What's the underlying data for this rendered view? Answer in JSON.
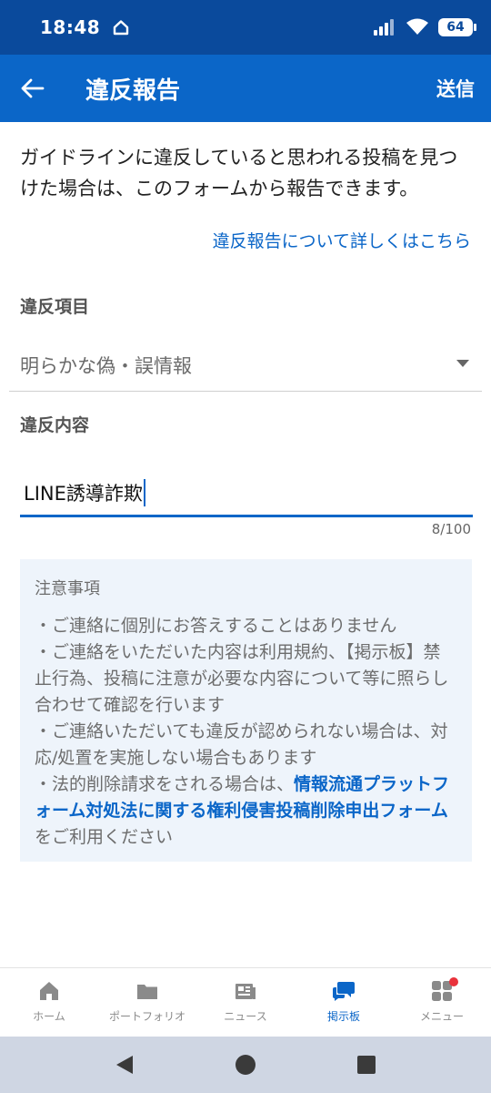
{
  "status_bar": {
    "time": "18:48",
    "battery": "64"
  },
  "app_bar": {
    "title": "違反報告",
    "send_label": "送信"
  },
  "intro": {
    "text": "ガイドラインに違反していると思われる投稿を見つけた場合は、このフォームから報告できます。",
    "details_link": "違反報告について詳しくはこちら"
  },
  "form": {
    "category_label": "違反項目",
    "category_value": "明らかな偽・誤情報",
    "content_label": "違反内容",
    "content_value": "LINE誘導詐欺",
    "counter": "8/100"
  },
  "notice": {
    "title": "注意事項",
    "line1": "・ご連絡に個別にお答えすることはありません",
    "line2": "・ご連絡をいただいた内容は利用規約、【掲示板】禁止行為、投稿に注意が必要な内容について等に照らし合わせて確認を行います",
    "line3": "・ご連絡いただいても違反が認められない場合は、対応/処置を実施しない場合もあります",
    "line4_prefix": "・法的削除請求をされる場合は、",
    "line4_link": "情報流通プラットフォーム対処法に関する権利侵害投稿削除申出フォーム",
    "line4_suffix": "をご利用ください"
  },
  "bottom_nav": {
    "items": [
      {
        "label": "ホーム",
        "icon": "home-icon"
      },
      {
        "label": "ポートフォリオ",
        "icon": "folder-icon"
      },
      {
        "label": "ニュース",
        "icon": "newspaper-icon"
      },
      {
        "label": "掲示板",
        "icon": "chat-bubbles-icon"
      },
      {
        "label": "メニュー",
        "icon": "grid-icon"
      }
    ],
    "active_index": 3
  },
  "colors": {
    "status_bar": "#0a4a9c",
    "app_bar": "#0b66c8",
    "accent": "#0b66c8",
    "notice_bg": "#eef4fb",
    "badge": "#e9323b"
  }
}
